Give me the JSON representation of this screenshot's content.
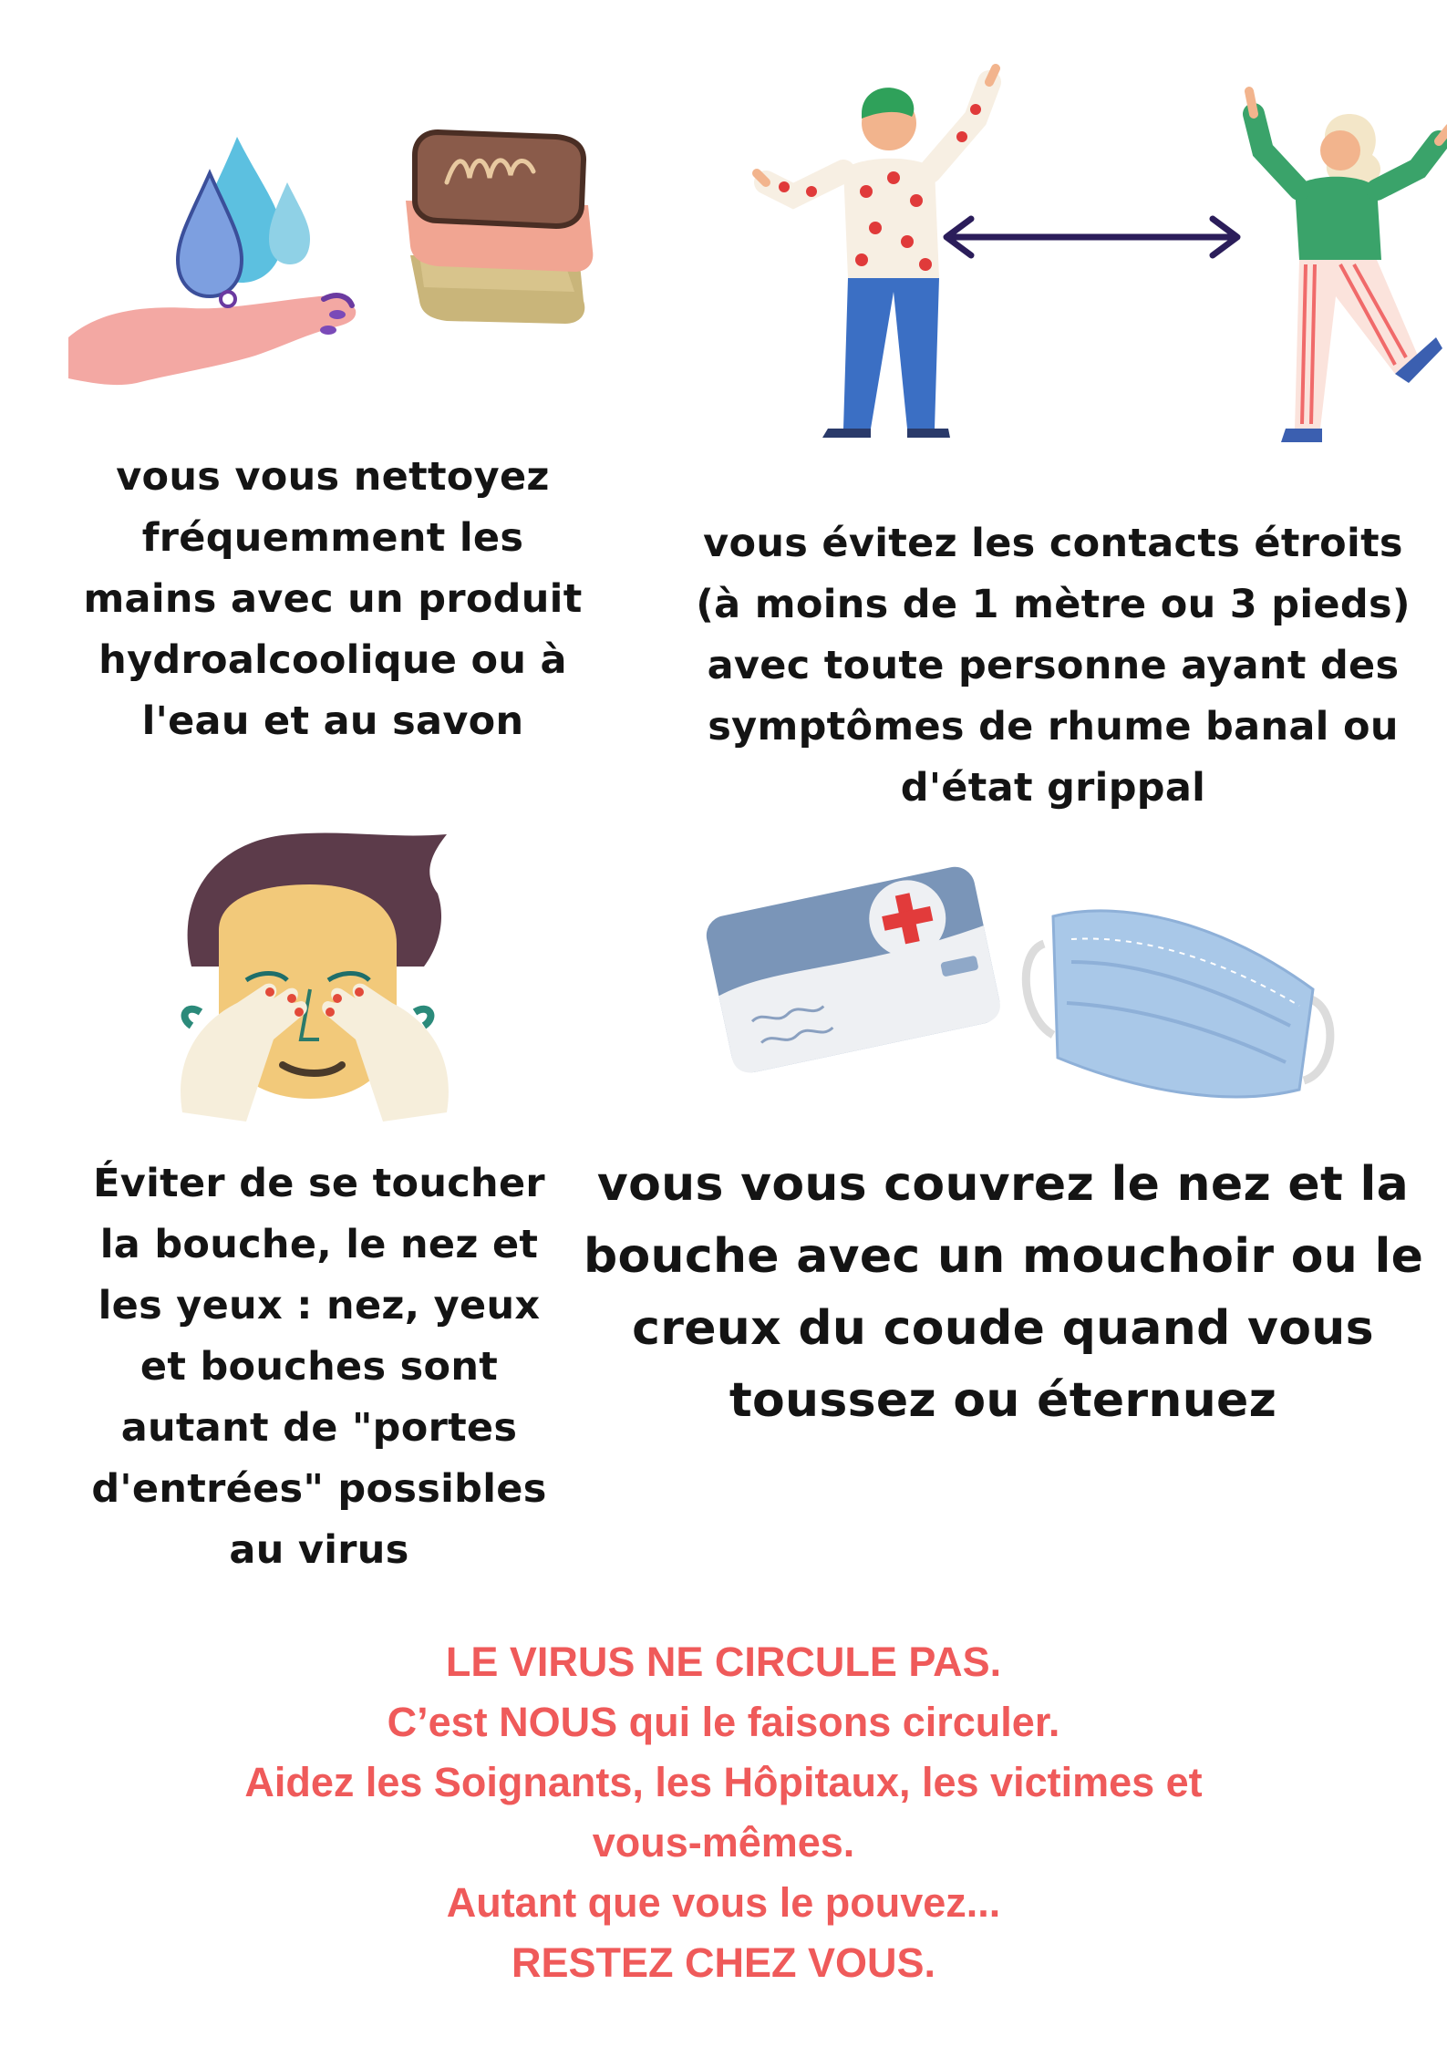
{
  "tips": [
    {
      "id": "hand-washing",
      "lines": [
        "vous vous nettoyez",
        "fréquemment les",
        "mains avec un produit",
        "hydroalcoolique ou à",
        "l'eau et au savon"
      ]
    },
    {
      "id": "distance",
      "lines": [
        "vous évitez les contacts étroits",
        "(à moins de 1 mètre ou 3 pieds)",
        "avec toute personne ayant des",
        "symptômes de rhume banal ou",
        "d'état grippal"
      ]
    },
    {
      "id": "face-touch",
      "lines": [
        "Éviter de se toucher",
        "la bouche, le nez et",
        "les yeux : nez, yeux",
        "et bouches sont",
        "autant de \"portes",
        "d'entrées\" possibles",
        "au virus"
      ]
    },
    {
      "id": "cover",
      "lines": [
        "vous vous couvrez le nez et la",
        "bouche avec un mouchoir ou le",
        "creux du coude quand vous",
        "toussez ou éternuez"
      ]
    }
  ],
  "footer": {
    "lines": [
      "LE VIRUS NE CIRCULE PAS.",
      "C’est NOUS qui le faisons circuler.",
      "Aidez les Soignants, les Hôpitaux, les victimes et",
      "vous-mêmes.",
      "Autant que vous le pouvez...",
      "RESTEZ CHEZ VOUS."
    ]
  },
  "colors": {
    "text": "#141414",
    "footer": "#ef5a5a",
    "arrow": "#2b1d5a",
    "water": "#5cc0e0",
    "skin": "#f3a8a3",
    "cross": "#e23b3b",
    "mask": "#a9c8e8"
  },
  "icons": [
    "water-drops-icon",
    "soap-bars-icon",
    "distance-arrow-icon",
    "face-touch-icon",
    "medical-card-icon",
    "face-mask-icon"
  ]
}
